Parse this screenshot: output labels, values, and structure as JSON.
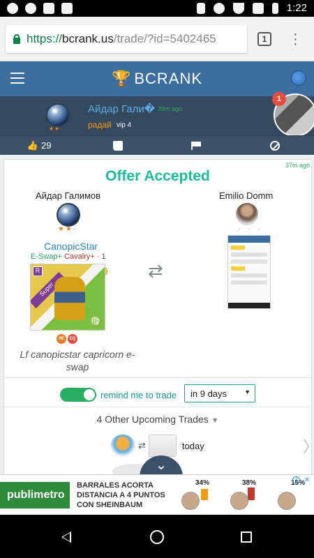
{
  "status_bar": {
    "time": "1:22"
  },
  "browser": {
    "url_scheme": "https://",
    "url_host": "bcrank.us",
    "url_path": "/trade/?id=5402465",
    "tab_count": "1"
  },
  "app": {
    "brand": "BCRANK"
  },
  "user_strip": {
    "name": "Айдар Гали�",
    "time_ago": "39m ago",
    "city": "радай",
    "vip": "vip 4",
    "stars": "★★·",
    "notification_count": "1",
    "likes": "29"
  },
  "offer": {
    "title": "Offer Accepted",
    "time_ago": "37m ago",
    "left_party": "Айдар Галимов",
    "left_stars": "★★·",
    "right_party": "Emilio Domm",
    "right_stars": "· · ·",
    "item_name": "CanopicStar",
    "tag_eswap": "E-Swap+",
    "tag_cavalry": "Cavalry+",
    "tag_level": "· 1",
    "rarity": "Super",
    "rarity_badge": "R",
    "zodiac": "♍",
    "badge_pe": "PE",
    "badge_eq": "EQ",
    "note": "Lf canopicstar capricorn e-swap"
  },
  "reminder": {
    "label": "remind me to trade",
    "selected_option": "in 9 days"
  },
  "upcoming": {
    "title": "4 Other Upcoming Trades",
    "first_trade_when": "today"
  },
  "ad": {
    "brand": "publimetro",
    "headline": "BARRALES ACORTA DISTANCIA A 4 PUNTOS CON SHEINBAUM",
    "percents": [
      "34%",
      "38%",
      "15%"
    ]
  }
}
